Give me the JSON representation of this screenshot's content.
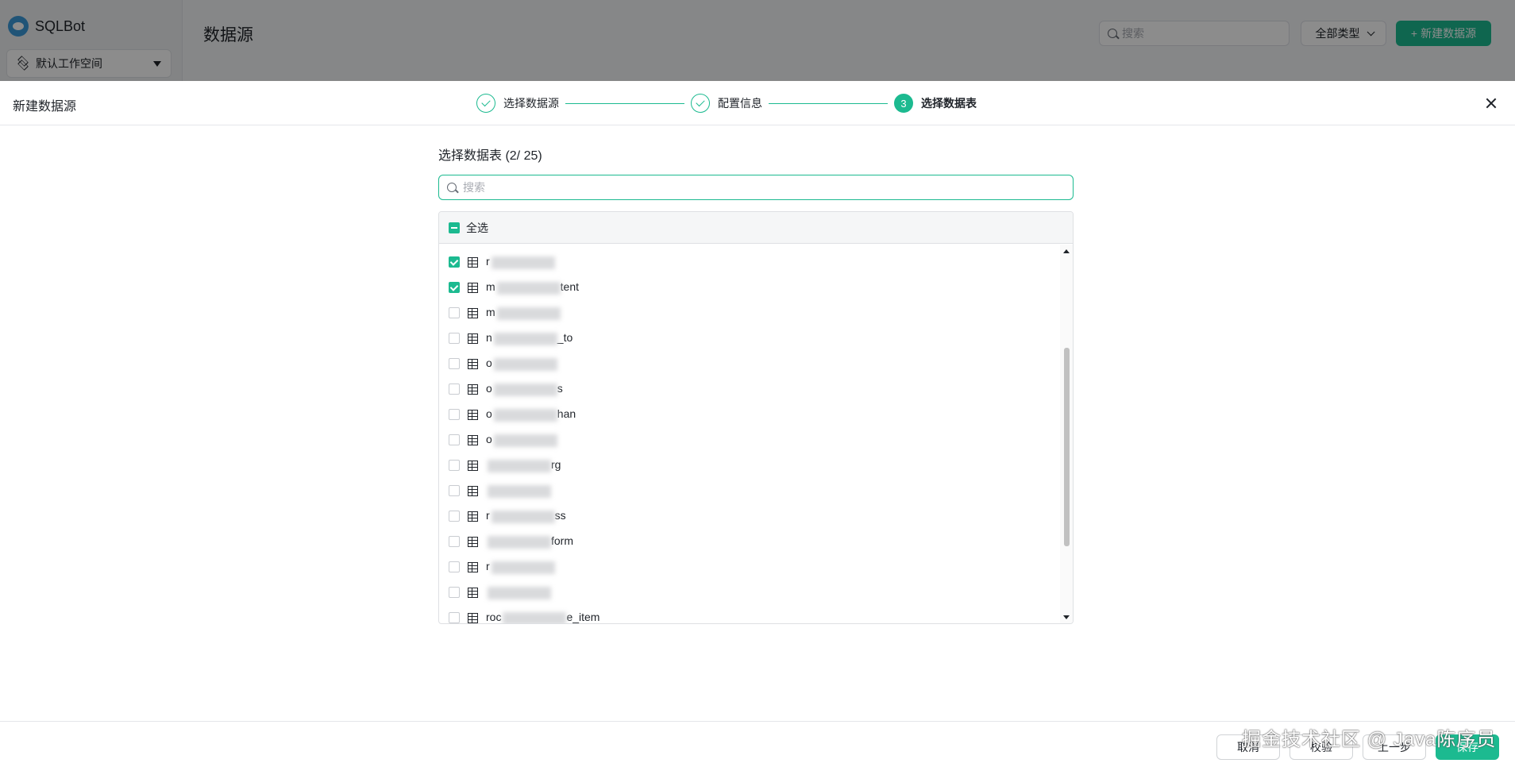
{
  "app": {
    "name": "SQLBot",
    "workspace": "默认工作空间",
    "page_title": "数据源",
    "search_placeholder": "搜索",
    "type_filter": "全部类型",
    "new_datasource": "新建数据源"
  },
  "drawer": {
    "title": "新建数据源",
    "steps": [
      {
        "number": "1",
        "label": "选择数据源",
        "status": "done"
      },
      {
        "number": "2",
        "label": "配置信息",
        "status": "done"
      },
      {
        "number": "3",
        "label": "选择数据表",
        "status": "active"
      }
    ],
    "table_selector": {
      "title": "选择数据表 (2/ 25)",
      "search_placeholder": "搜索",
      "select_all": "全选",
      "rows": [
        {
          "prefix": "r",
          "suffix": "",
          "checked": true
        },
        {
          "prefix": "m",
          "suffix": "tent",
          "checked": true
        },
        {
          "prefix": "m",
          "suffix": "",
          "checked": false
        },
        {
          "prefix": "n",
          "suffix": "_to",
          "checked": false
        },
        {
          "prefix": "o",
          "suffix": "",
          "checked": false
        },
        {
          "prefix": "o",
          "suffix": "s",
          "checked": false
        },
        {
          "prefix": "o",
          "suffix": "han",
          "checked": false
        },
        {
          "prefix": "o",
          "suffix": "",
          "checked": false
        },
        {
          "prefix": "",
          "suffix": "rg",
          "checked": false
        },
        {
          "prefix": "",
          "suffix": "",
          "checked": false
        },
        {
          "prefix": "r",
          "suffix": "ss",
          "checked": false
        },
        {
          "prefix": "",
          "suffix": "form",
          "checked": false
        },
        {
          "prefix": "r",
          "suffix": "",
          "checked": false
        },
        {
          "prefix": "",
          "suffix": "",
          "checked": false
        },
        {
          "prefix": "roc",
          "suffix": "e_item",
          "checked": false
        }
      ]
    },
    "footer": {
      "cancel": "取消",
      "validate": "校验",
      "prev": "上一步",
      "save": "保存",
      "watermark": "掘金技术社区 @ Java陈序员"
    }
  },
  "colors": {
    "accent": "#1cba90",
    "text": "#1f2329",
    "border": "#dee0e3"
  }
}
